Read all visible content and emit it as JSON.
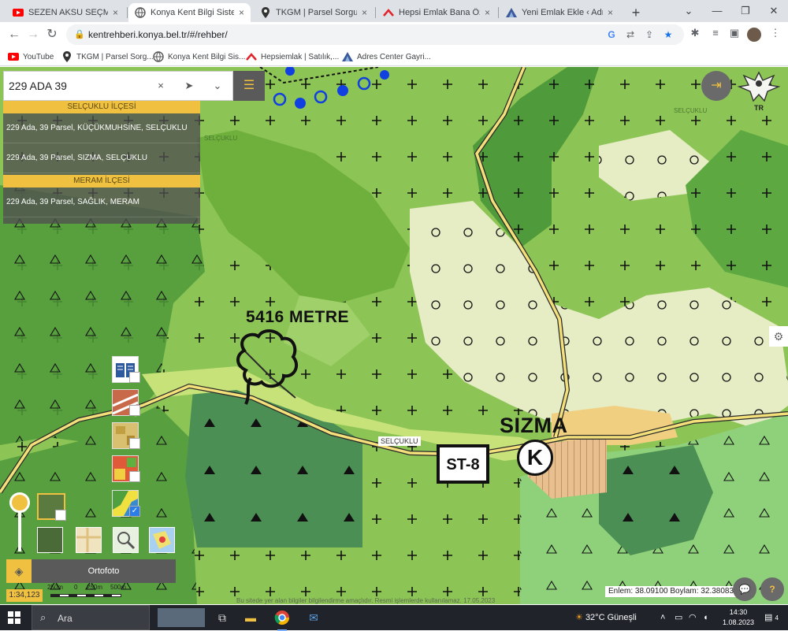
{
  "browser": {
    "tabs": [
      {
        "title": "SEZEN AKSU SEÇME ŞARKILAR",
        "icon": "youtube-icon",
        "active": false
      },
      {
        "title": "Konya Kent Bilgi Sistemi",
        "icon": "globe-icon",
        "active": true
      },
      {
        "title": "TKGM | Parsel Sorgu Uygulaması",
        "icon": "location-pin-icon",
        "active": false
      },
      {
        "title": "Hepsi Emlak Bana Özel",
        "icon": "hepsiemlak-icon",
        "active": false
      },
      {
        "title": "Yeni Emlak Ekle ‹ Adres Center",
        "icon": "adres-center-icon",
        "active": false
      }
    ],
    "url": "kentrehberi.konya.bel.tr/#/rehber/",
    "bookmarks": [
      {
        "label": "YouTube",
        "icon": "youtube-icon"
      },
      {
        "label": "TKGM | Parsel Sorg...",
        "icon": "location-pin-icon"
      },
      {
        "label": "Konya Kent Bilgi Sis...",
        "icon": "globe-icon"
      },
      {
        "label": "Hepsiemlak | Satılık,...",
        "icon": "hepsiemlak-icon"
      },
      {
        "label": "Adres Center Gayri...",
        "icon": "adres-center-icon"
      }
    ]
  },
  "search": {
    "value": "229 ADA 39",
    "clear_icon": "×",
    "locate_icon": "➤",
    "dropdown_icon": "⌄",
    "menu_icon": "☰"
  },
  "results": {
    "groups": [
      {
        "header": "SELÇUKLU İLÇESİ",
        "items": [
          "229 Ada, 39 Parsel, KÜÇÜKMUHSİNE, SELÇUKLU",
          "229 Ada, 39 Parsel, SIZMA, SELÇUKLU"
        ]
      },
      {
        "header": "MERAM İLÇESİ",
        "items": [
          "229 Ada, 39 Parsel, SAĞLIK, MERAM"
        ]
      }
    ]
  },
  "map": {
    "labels": {
      "distance": "5416 METRE",
      "village": "SIZMA",
      "road": "SELÇUKLU",
      "road_small_top": "SELÇUKLU",
      "road_small_left": "SELÇUKLU",
      "station": "ST-8",
      "k_marker": "K",
      "emblem_text": "TR"
    },
    "colors": {
      "light_green": "#8dc456",
      "mid_green": "#6fb03d",
      "dark_green": "#4f9a3a",
      "forest": "#4c8f55",
      "pale": "#e6ecc4",
      "yellow_green": "#c8e27a",
      "accent": "#f0c040",
      "road": "#f4e07a"
    }
  },
  "controls": {
    "basemap_name": "Ortofoto",
    "scale_ratio": "1:34,123",
    "scale_ticks": [
      "250m",
      "0",
      "250m",
      "500m"
    ],
    "coordinates": "Enlem: 38.09100 Boylam: 32.38083",
    "disclaimer": "Bu sitede yer alan bilgiler bilgilendirme amaçlıdır. Resmi işlemlerde kullanılamaz. 17.05.2023",
    "chat_icon": "💬",
    "help_icon": "?",
    "login_icon": "⇥",
    "settings_icon": "⚙",
    "layers_icon": "◈"
  },
  "taskbar": {
    "search_placeholder": "Ara",
    "weather": "32°C  Güneşli",
    "time": "14:30",
    "date": "1.08.2023",
    "notifications": "4"
  }
}
